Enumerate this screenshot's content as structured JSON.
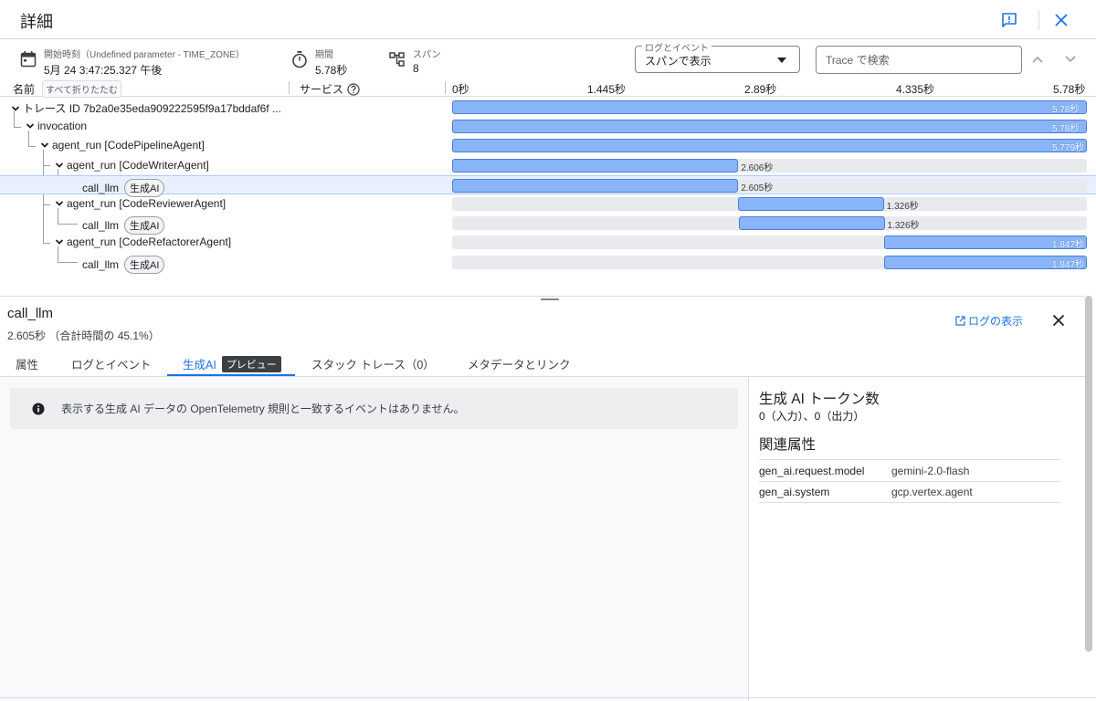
{
  "header": {
    "title": "詳細"
  },
  "meta": {
    "start_label": "開始時刻（Undefined parameter - TIME_ZONE）",
    "start_value": "5月 24 3:47:25.327 午後",
    "duration_label": "期間",
    "duration_value": "5.78秒",
    "span_label": "スパン",
    "span_value": "8",
    "log_select_label": "ログとイベント",
    "log_select_value": "スパンで表示",
    "search_placeholder": "Trace で検索"
  },
  "trace_header": {
    "name_col": "名前",
    "collapse_all": "すべて折りたたむ",
    "service_col": "サービス",
    "ticks": [
      "0秒",
      "1.445秒",
      "2.89秒",
      "4.335秒",
      "5.78秒"
    ]
  },
  "spans": [
    {
      "label": "トレース ID 7b2a0e35eda909222595f9a17bddaf6f ...",
      "start": 0,
      "duration": 5.78,
      "duration_label": "5.78秒"
    },
    {
      "label": "invocation",
      "start": 0,
      "duration": 5.78,
      "duration_label": "5.78秒"
    },
    {
      "label": "agent_run [CodePipelineAgent]",
      "start": 0,
      "duration": 5.779,
      "duration_label": "5.779秒"
    },
    {
      "label": "agent_run [CodeWriterAgent]",
      "start": 0,
      "duration": 2.606,
      "duration_label": "2.606秒"
    },
    {
      "label": "call_llm",
      "badge": "生成AI",
      "start": 0,
      "duration": 2.605,
      "duration_label": "2.605秒",
      "selected": true
    },
    {
      "label": "agent_run [CodeReviewerAgent]",
      "start": 2.606,
      "duration": 1.326,
      "duration_label": "1.326秒"
    },
    {
      "label": "call_llm",
      "badge": "生成AI",
      "start": 2.612,
      "duration": 1.326,
      "duration_label": "1.326秒"
    },
    {
      "label": "agent_run [CodeRefactorerAgent]",
      "start": 3.933,
      "duration": 1.847,
      "duration_label": "1.847秒"
    },
    {
      "label": "call_llm",
      "badge": "生成AI",
      "start": 3.933,
      "duration": 1.847,
      "duration_label": "1.847秒"
    }
  ],
  "detail": {
    "title": "call_llm",
    "subtitle": "2.605秒 （合計時間の 45.1%）",
    "logs_link": "ログの表示",
    "tabs": [
      "属性",
      "ログとイベント",
      "生成AI",
      "スタック トレース（0）",
      "メタデータとリンク"
    ],
    "preview_badge": "プレビュー",
    "info_message": "表示する生成 AI データの OpenTelemetry 規則と一致するイベントはありません。",
    "token_title": "生成 AI トークン数",
    "token_value": "0（入力）、0（出力）",
    "related_title": "関連属性",
    "attributes": [
      {
        "key": "gen_ai.request.model",
        "value": "gemini-2.0-flash"
      },
      {
        "key": "gen_ai.system",
        "value": "gcp.vertex.agent"
      }
    ]
  },
  "colors": {
    "accent": "#1a73e8",
    "bar_fill": "#8ab4f8",
    "bar_border": "#4a7fd4",
    "track": "#e8eaed",
    "selected_row": "#e8f0fe"
  }
}
